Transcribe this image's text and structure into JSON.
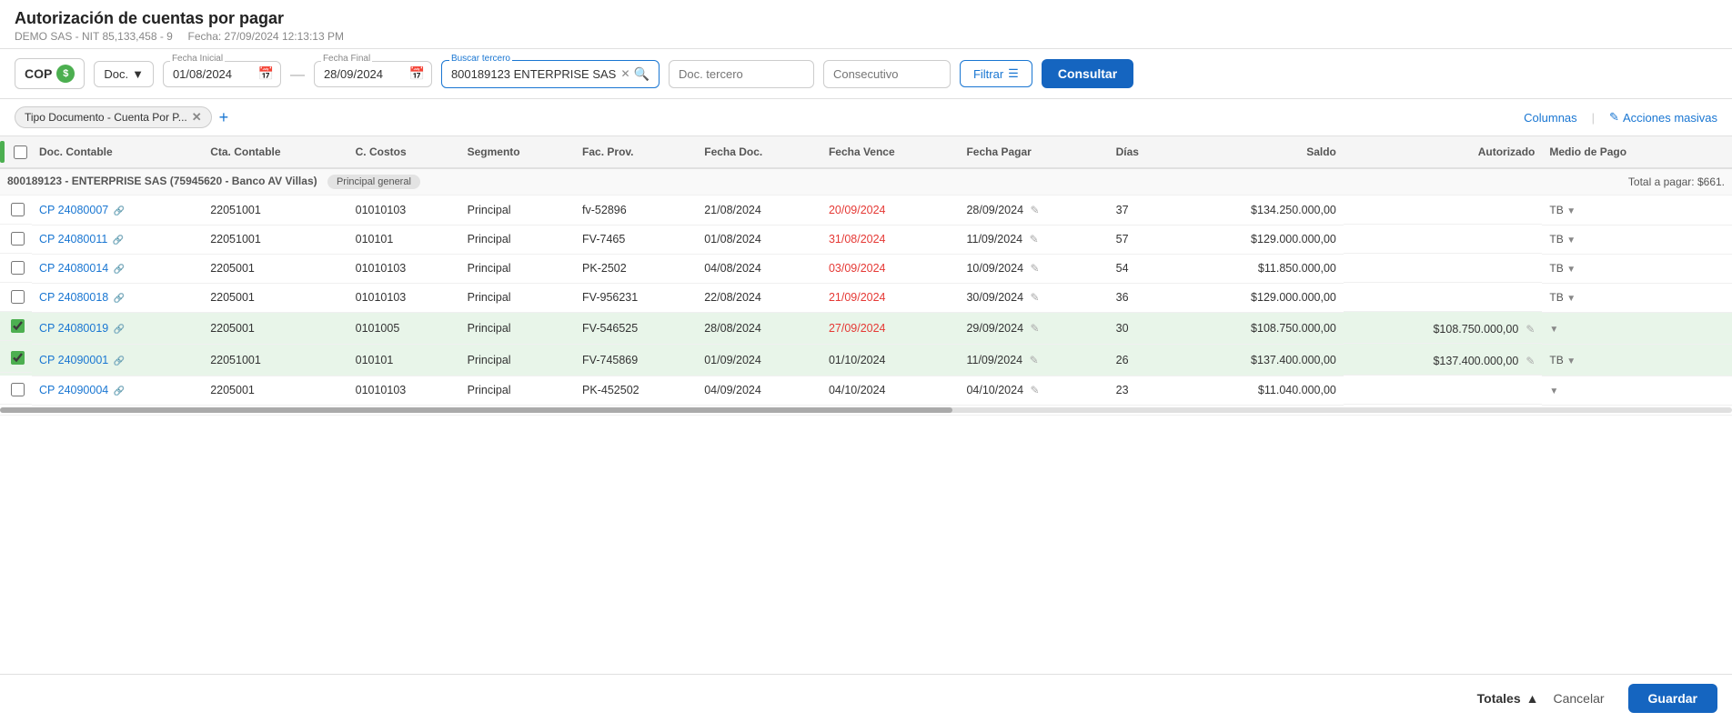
{
  "page": {
    "title": "Autorización de cuentas por pagar",
    "subtitle_company": "DEMO SAS - NIT 85,133,458 - 9",
    "subtitle_date": "Fecha: 27/09/2024 12:13:13 PM"
  },
  "toolbar": {
    "currency": "COP",
    "currency_icon": "$",
    "doc_label": "Doc.",
    "fecha_inicial_label": "Fecha Inicial",
    "fecha_inicial_value": "01/08/2024",
    "fecha_final_label": "Fecha Final",
    "fecha_final_value": "28/09/2024",
    "buscar_tercero_label": "Buscar tercero",
    "buscar_tercero_value": "800189123 ENTERPRISE SAS",
    "doc_tercero_placeholder": "Doc. tercero",
    "consecutivo_placeholder": "Consecutivo",
    "filtrar_label": "Filtrar",
    "consultar_label": "Consultar"
  },
  "filter_tags": {
    "tag1": "Tipo Documento - Cuenta Por P...",
    "columnas_label": "Columnas",
    "acciones_masivas_label": "Acciones masivas"
  },
  "table": {
    "columns": [
      "Doc. Contable",
      "Cta. Contable",
      "C. Costos",
      "Segmento",
      "Fac. Prov.",
      "Fecha Doc.",
      "Fecha Vence",
      "Fecha Pagar",
      "Días",
      "Saldo",
      "Autorizado",
      "Medio de Pago"
    ],
    "group": {
      "label": "800189123 - ENTERPRISE SAS (75945620 - Banco AV Villas)",
      "badge": "Principal general",
      "total": "Total a pagar: $661."
    },
    "rows": [
      {
        "id": "row1",
        "checked": false,
        "doc": "CP 24080007",
        "cta": "22051001",
        "costos": "01010103",
        "segmento": "Principal",
        "fac": "fv-52896",
        "fecha_doc": "21/08/2024",
        "fecha_vence": "20/09/2024",
        "fecha_vence_red": true,
        "fecha_pagar": "28/09/2024",
        "dias": "37",
        "saldo": "$134.250.000,00",
        "autorizado": "",
        "medio_pago": "TB"
      },
      {
        "id": "row2",
        "checked": false,
        "doc": "CP 24080011",
        "cta": "22051001",
        "costos": "010101",
        "segmento": "Principal",
        "fac": "FV-7465",
        "fecha_doc": "01/08/2024",
        "fecha_vence": "31/08/2024",
        "fecha_vence_red": true,
        "fecha_pagar": "11/09/2024",
        "dias": "57",
        "saldo": "$129.000.000,00",
        "autorizado": "",
        "medio_pago": "TB"
      },
      {
        "id": "row3",
        "checked": false,
        "doc": "CP 24080014",
        "cta": "2205001",
        "costos": "01010103",
        "segmento": "Principal",
        "fac": "PK-2502",
        "fecha_doc": "04/08/2024",
        "fecha_vence": "03/09/2024",
        "fecha_vence_red": true,
        "fecha_pagar": "10/09/2024",
        "dias": "54",
        "saldo": "$11.850.000,00",
        "autorizado": "",
        "medio_pago": "TB"
      },
      {
        "id": "row4",
        "checked": false,
        "doc": "CP 24080018",
        "cta": "2205001",
        "costos": "01010103",
        "segmento": "Principal",
        "fac": "FV-956231",
        "fecha_doc": "22/08/2024",
        "fecha_vence": "21/09/2024",
        "fecha_vence_red": true,
        "fecha_pagar": "30/09/2024",
        "dias": "36",
        "saldo": "$129.000.000,00",
        "autorizado": "",
        "medio_pago": "TB"
      },
      {
        "id": "row5",
        "checked": true,
        "doc": "CP 24080019",
        "cta": "2205001",
        "costos": "0101005",
        "segmento": "Principal",
        "fac": "FV-546525",
        "fecha_doc": "28/08/2024",
        "fecha_vence": "27/09/2024",
        "fecha_vence_red": true,
        "fecha_pagar": "29/09/2024",
        "dias": "30",
        "saldo": "$108.750.000,00",
        "autorizado": "$108.750.000,00",
        "medio_pago": ""
      },
      {
        "id": "row6",
        "checked": true,
        "doc": "CP 24090001",
        "cta": "22051001",
        "costos": "010101",
        "segmento": "Principal",
        "fac": "FV-745869",
        "fecha_doc": "01/09/2024",
        "fecha_vence": "01/10/2024",
        "fecha_vence_red": false,
        "fecha_pagar": "11/09/2024",
        "dias": "26",
        "saldo": "$137.400.000,00",
        "autorizado": "$137.400.000,00",
        "medio_pago": "TB"
      },
      {
        "id": "row7",
        "checked": false,
        "doc": "CP 24090004",
        "cta": "2205001",
        "costos": "01010103",
        "segmento": "Principal",
        "fac": "PK-452502",
        "fecha_doc": "04/09/2024",
        "fecha_vence": "04/10/2024",
        "fecha_vence_red": false,
        "fecha_pagar": "04/10/2024",
        "dias": "23",
        "saldo": "$11.040.000,00",
        "autorizado": "",
        "medio_pago": ""
      }
    ]
  },
  "footer": {
    "totales_label": "Totales",
    "cancel_label": "Cancelar",
    "guardar_label": "Guardar"
  }
}
